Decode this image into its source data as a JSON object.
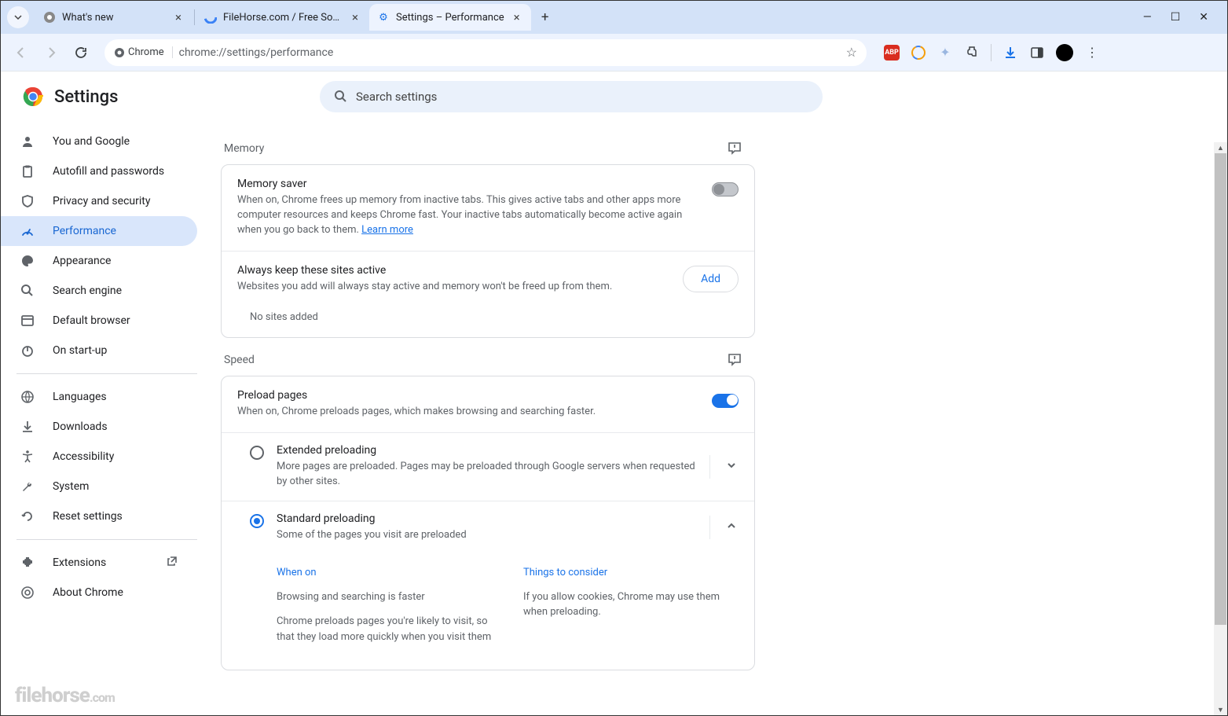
{
  "window": {
    "minimize": "—",
    "maximize": "☐",
    "close": "✕"
  },
  "tabs": [
    {
      "title": "What's new",
      "favicon": "chrome"
    },
    {
      "title": "FileHorse.com / Free Software",
      "favicon": "filehorse"
    },
    {
      "title": "Settings – Performance",
      "favicon": "gear",
      "active": true
    }
  ],
  "omnibox": {
    "chip": "Chrome",
    "url": "chrome://settings/performance"
  },
  "page_title": "Settings",
  "search": {
    "placeholder": "Search settings"
  },
  "sidebar": {
    "items": [
      {
        "icon": "person",
        "label": "You and Google"
      },
      {
        "icon": "clipboard",
        "label": "Autofill and passwords"
      },
      {
        "icon": "shield",
        "label": "Privacy and security"
      },
      {
        "icon": "speed",
        "label": "Performance",
        "active": true
      },
      {
        "icon": "palette",
        "label": "Appearance"
      },
      {
        "icon": "search",
        "label": "Search engine"
      },
      {
        "icon": "browser",
        "label": "Default browser"
      },
      {
        "icon": "power",
        "label": "On start-up"
      }
    ],
    "items2": [
      {
        "icon": "globe",
        "label": "Languages"
      },
      {
        "icon": "download",
        "label": "Downloads"
      },
      {
        "icon": "accessibility",
        "label": "Accessibility"
      },
      {
        "icon": "wrench",
        "label": "System"
      },
      {
        "icon": "reset",
        "label": "Reset settings"
      }
    ],
    "items3": [
      {
        "icon": "puzzle",
        "label": "Extensions",
        "external": true
      },
      {
        "icon": "chrome",
        "label": "About Chrome"
      }
    ]
  },
  "sections": {
    "memory": {
      "heading": "Memory",
      "saver_title": "Memory saver",
      "saver_desc": "When on, Chrome frees up memory from inactive tabs. This gives active tabs and other apps more computer resources and keeps Chrome fast. Your inactive tabs automatically become active again when you go back to them. ",
      "learn_more": "Learn more",
      "active_title": "Always keep these sites active",
      "active_desc": "Websites you add will always stay active and memory won't be freed up from them.",
      "add": "Add",
      "no_sites": "No sites added"
    },
    "speed": {
      "heading": "Speed",
      "preload_title": "Preload pages",
      "preload_desc": "When on, Chrome preloads pages, which makes browsing and searching faster.",
      "extended_title": "Extended preloading",
      "extended_desc": "More pages are preloaded. Pages may be preloaded through Google servers when requested by other sites.",
      "standard_title": "Standard preloading",
      "standard_desc": "Some of the pages you visit are preloaded",
      "when_on_h": "When on",
      "when_on_1": "Browsing and searching is faster",
      "when_on_2": "Chrome preloads pages you're likely to visit, so that they load more quickly when you visit them",
      "consider_h": "Things to consider",
      "consider_1": "If you allow cookies, Chrome may use them when preloading."
    }
  },
  "watermark": "filehorse",
  "watermark_dom": ".com"
}
